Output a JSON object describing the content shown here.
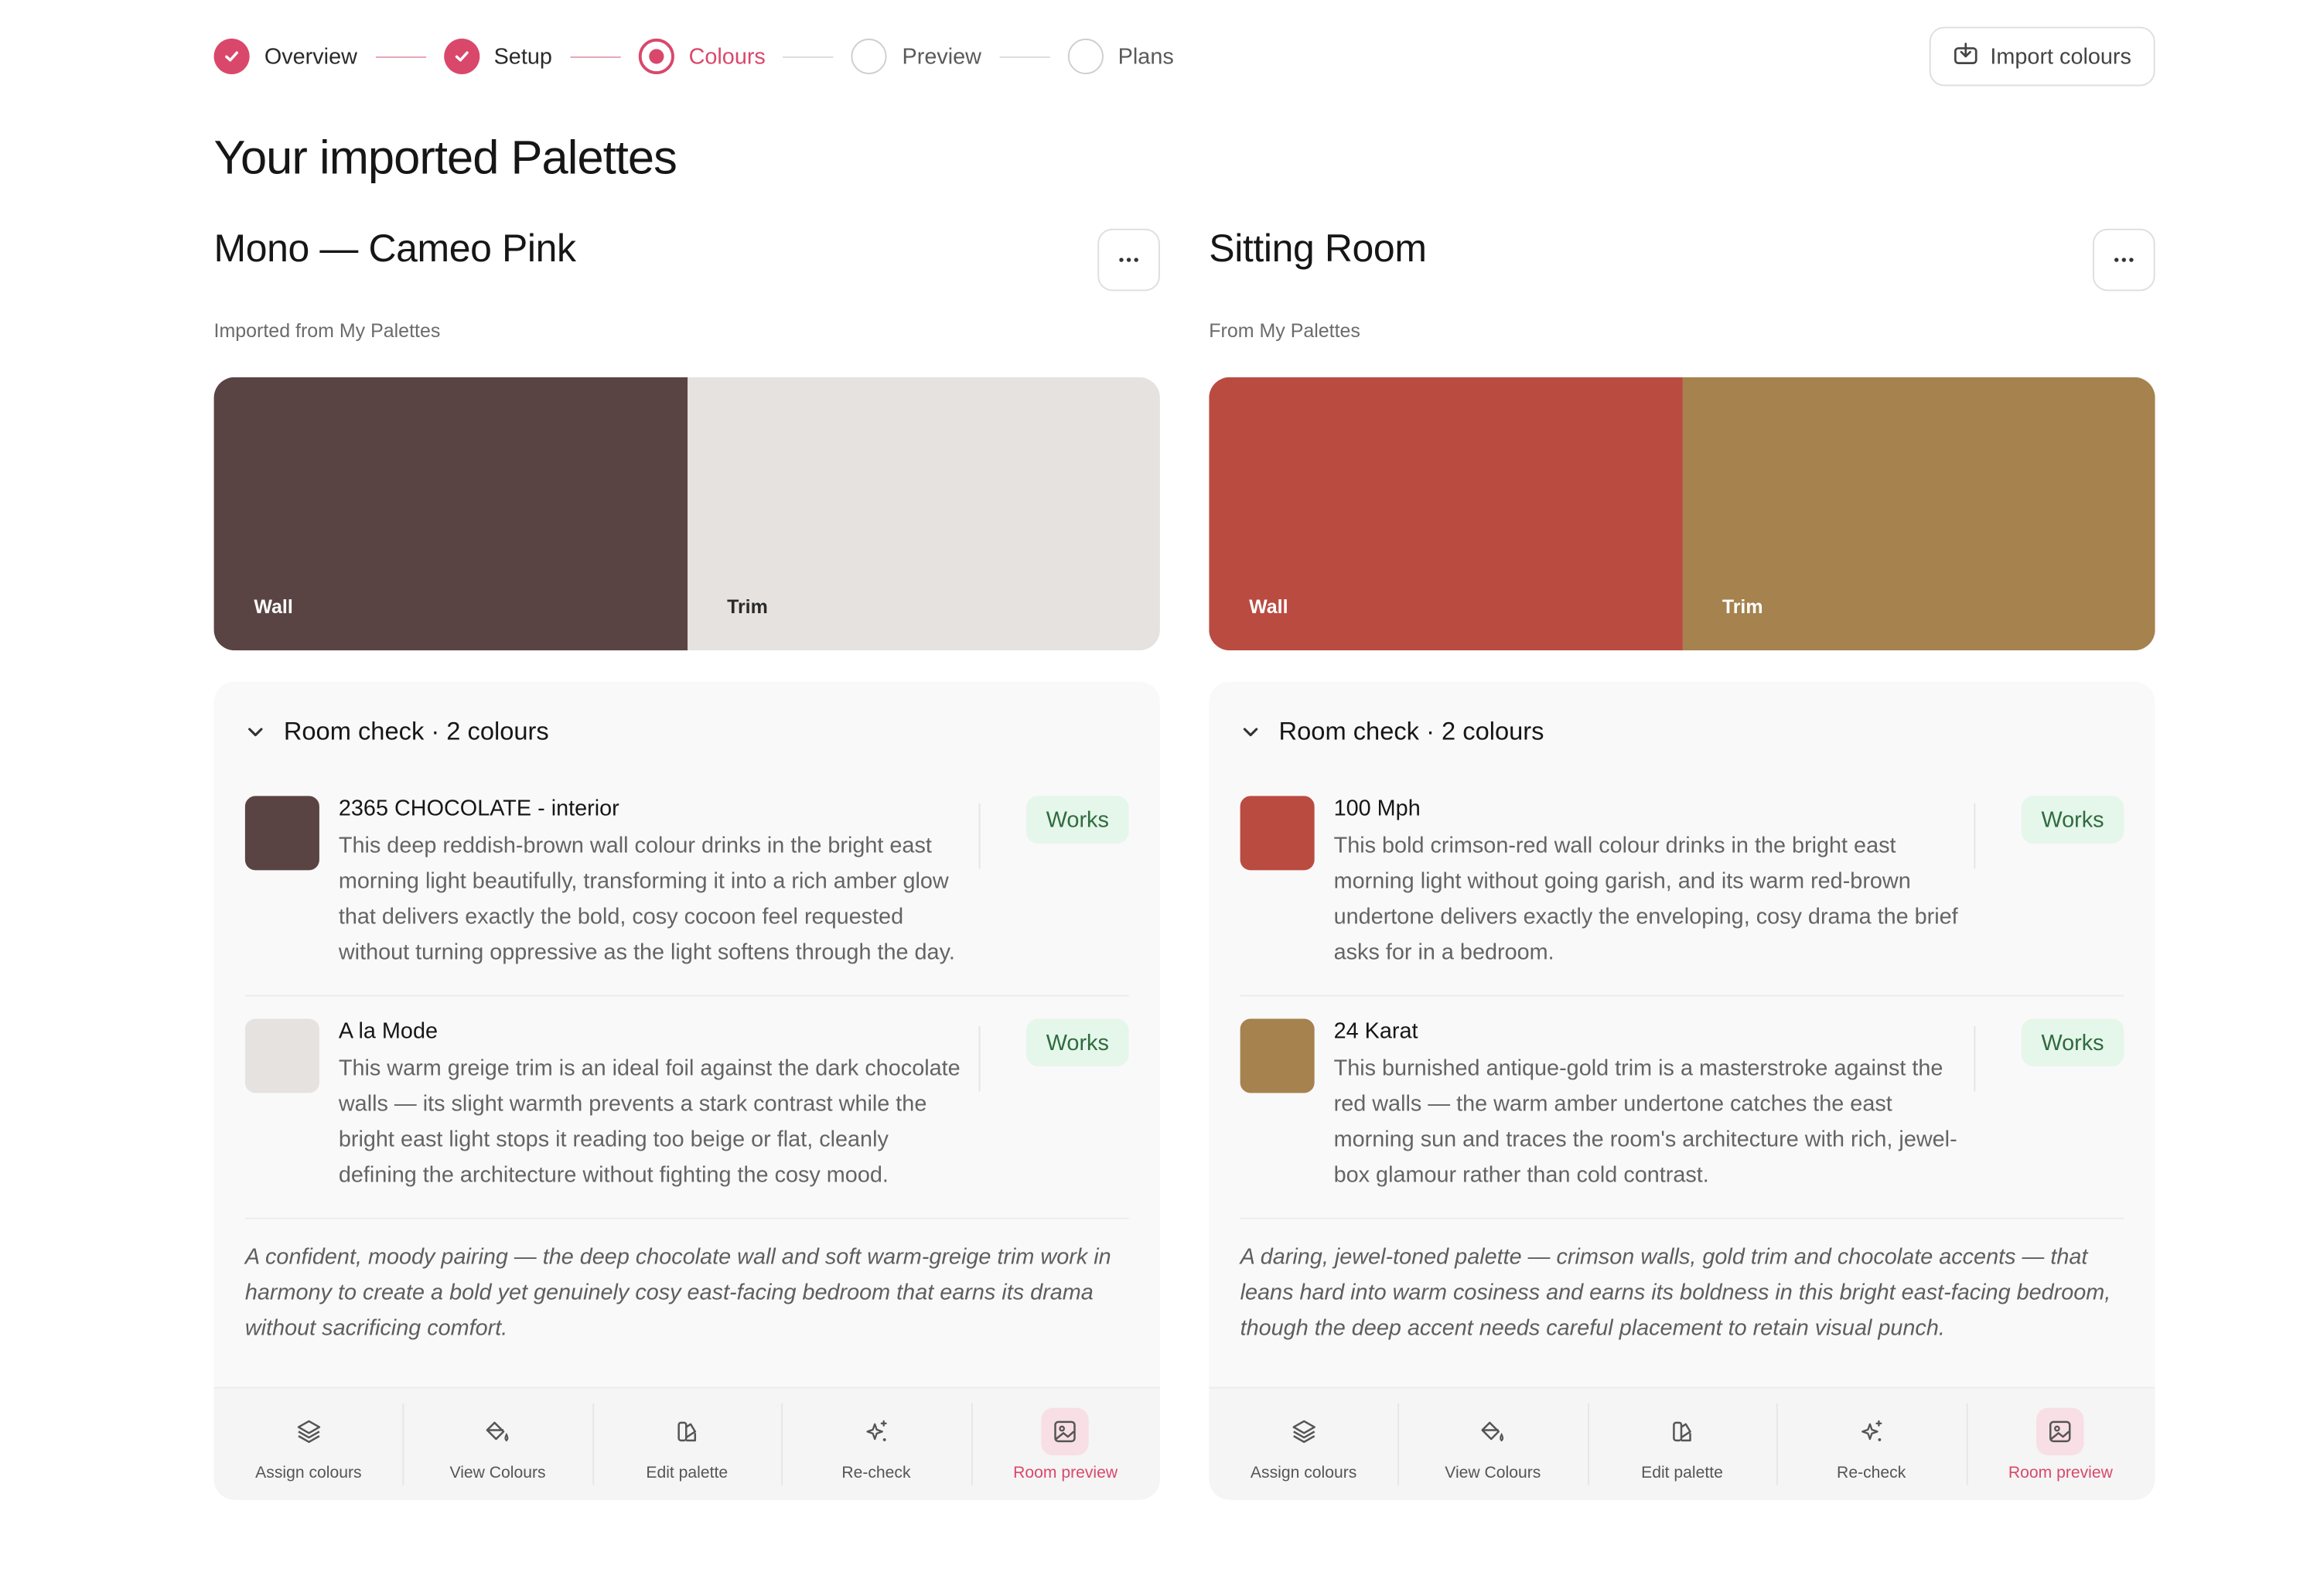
{
  "stepper": [
    {
      "label": "Overview",
      "state": "done"
    },
    {
      "label": "Setup",
      "state": "done"
    },
    {
      "label": "Colours",
      "state": "current"
    },
    {
      "label": "Preview",
      "state": "todo"
    },
    {
      "label": "Plans",
      "state": "todo"
    }
  ],
  "header": {
    "import_label": "Import colours",
    "page_title": "Your imported Palettes"
  },
  "colors": {
    "accent": "#d9486b",
    "works_bg": "#e5f6ea",
    "works_text": "#2f6b3f"
  },
  "palettes": [
    {
      "title": "Mono — Cameo Pink",
      "subtitle": "Imported from My Palettes",
      "swatches": [
        {
          "label": "Wall",
          "color": "#5a4343",
          "text_color": "#ffffff"
        },
        {
          "label": "Trim",
          "color": "#e6e2df",
          "text_color": "#2a2a2a"
        }
      ],
      "room_check_title": "Room check · 2 colours",
      "items": [
        {
          "name": "2365 CHOCOLATE - interior",
          "color": "#5a4343",
          "badge": "Works",
          "desc": "This deep reddish-brown wall colour drinks in the bright east morning light beautifully, transforming it into a rich amber glow that delivers exactly the bold, cosy cocoon feel requested without turning oppressive as the light softens through the day."
        },
        {
          "name": "A la Mode",
          "color": "#e6e2df",
          "badge": "Works",
          "desc": "This warm greige trim is an ideal foil against the dark chocolate walls — its slight warmth prevents a stark contrast while the bright east light stops it reading too beige or flat, cleanly defining the architecture without fighting the cosy mood."
        }
      ],
      "summary": "A confident, moody pairing — the deep chocolate wall and soft warm-greige trim work in harmony to create a bold yet genuinely cosy east-facing bedroom that earns its drama without sacrificing comfort.",
      "actions": [
        {
          "label": "Assign colours",
          "icon": "layers-icon"
        },
        {
          "label": "View Colours",
          "icon": "paint-bucket-icon"
        },
        {
          "label": "Edit palette",
          "icon": "swatch-book-icon"
        },
        {
          "label": "Re-check",
          "icon": "sparkles-icon"
        },
        {
          "label": "Room preview",
          "icon": "image-icon",
          "active": true
        }
      ]
    },
    {
      "title": "Sitting Room",
      "subtitle": "From My Palettes",
      "swatches": [
        {
          "label": "Wall",
          "color": "#ba4b41",
          "text_color": "#ffffff"
        },
        {
          "label": "Trim",
          "color": "#a5824e",
          "text_color": "#ffffff"
        }
      ],
      "room_check_title": "Room check · 2 colours",
      "items": [
        {
          "name": "100 Mph",
          "color": "#ba4b41",
          "badge": "Works",
          "desc": "This bold crimson-red wall colour drinks in the bright east morning light without going garish, and its warm red-brown undertone delivers exactly the enveloping, cosy drama the brief asks for in a bedroom."
        },
        {
          "name": "24 Karat",
          "color": "#a5824e",
          "badge": "Works",
          "desc": "This burnished antique-gold trim is a masterstroke against the red walls — the warm amber undertone catches the east morning sun and traces the room's architecture with rich, jewel-box glamour rather than cold contrast."
        }
      ],
      "summary": "A daring, jewel-toned palette — crimson walls, gold trim and chocolate accents — that leans hard into warm cosiness and earns its boldness in this bright east-facing bedroom, though the deep accent needs careful placement to retain visual punch.",
      "actions": [
        {
          "label": "Assign colours",
          "icon": "layers-icon"
        },
        {
          "label": "View Colours",
          "icon": "paint-bucket-icon"
        },
        {
          "label": "Edit palette",
          "icon": "swatch-book-icon"
        },
        {
          "label": "Re-check",
          "icon": "sparkles-icon"
        },
        {
          "label": "Room preview",
          "icon": "image-icon",
          "active": true
        }
      ]
    }
  ]
}
